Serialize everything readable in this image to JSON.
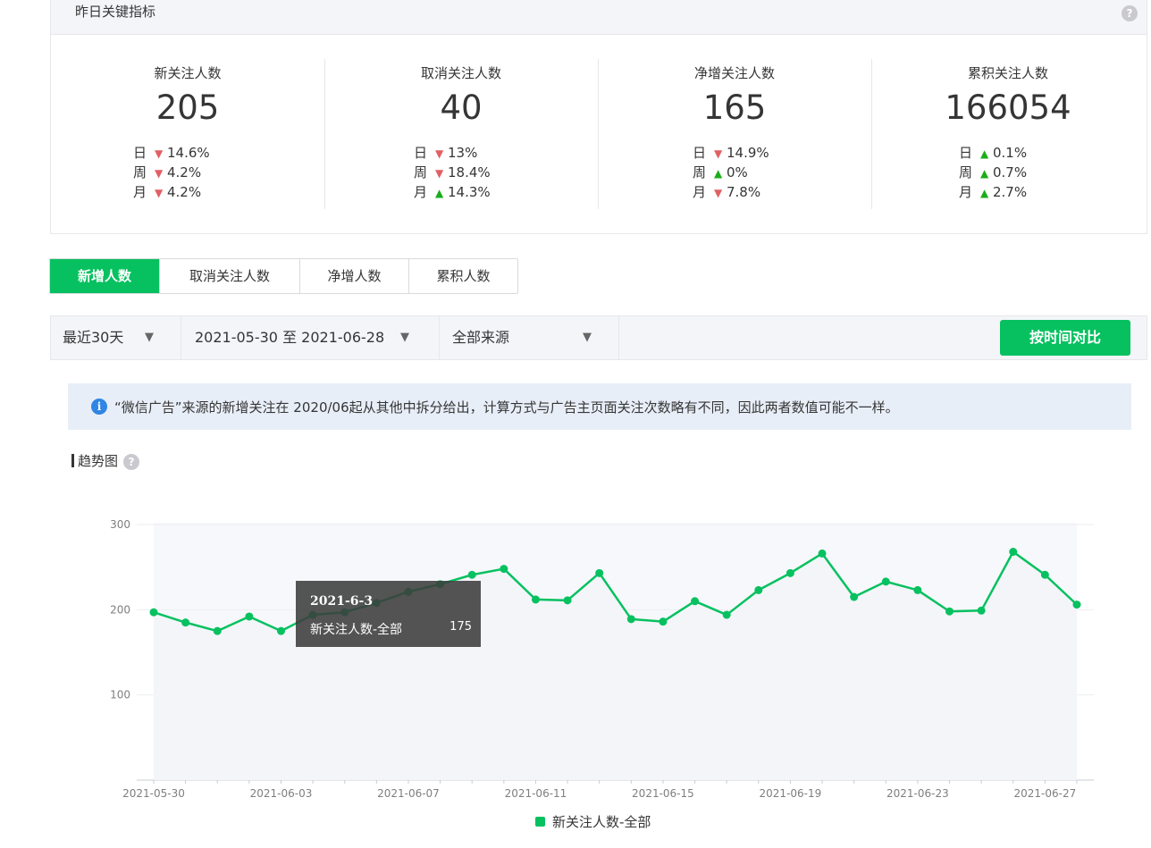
{
  "summary": {
    "title": "昨日关键指标",
    "metrics": [
      {
        "label": "新关注人数",
        "value": "205",
        "rows": [
          {
            "k": "日",
            "dir": "down",
            "v": "14.6%"
          },
          {
            "k": "周",
            "dir": "down",
            "v": "4.2%"
          },
          {
            "k": "月",
            "dir": "down",
            "v": "4.2%"
          }
        ]
      },
      {
        "label": "取消关注人数",
        "value": "40",
        "rows": [
          {
            "k": "日",
            "dir": "down",
            "v": "13%"
          },
          {
            "k": "周",
            "dir": "down",
            "v": "18.4%"
          },
          {
            "k": "月",
            "dir": "up",
            "v": "14.3%"
          }
        ]
      },
      {
        "label": "净增关注人数",
        "value": "165",
        "rows": [
          {
            "k": "日",
            "dir": "down",
            "v": "14.9%"
          },
          {
            "k": "周",
            "dir": "up",
            "v": "0%"
          },
          {
            "k": "月",
            "dir": "down",
            "v": "7.8%"
          }
        ]
      },
      {
        "label": "累积关注人数",
        "value": "166054",
        "rows": [
          {
            "k": "日",
            "dir": "up",
            "v": "0.1%"
          },
          {
            "k": "周",
            "dir": "up",
            "v": "0.7%"
          },
          {
            "k": "月",
            "dir": "up",
            "v": "2.7%"
          }
        ]
      }
    ]
  },
  "tabs": [
    "新增人数",
    "取消关注人数",
    "净增人数",
    "累积人数"
  ],
  "filters": {
    "period": "最近30天",
    "date_range": "2021-05-30 至 2021-06-28",
    "source": "全部来源",
    "compare_button": "按时间对比"
  },
  "notice": "“微信广告”来源的新增关注在 2020/06起从其他中拆分给出，计算方式与广告主页面关注次数略有不同，因此两者数值可能不一样。",
  "trend_title": "趋势图",
  "tooltip": {
    "date": "2021-6-3",
    "label": "新关注人数-全部",
    "value": "175"
  },
  "colors": {
    "accent": "#07c160",
    "down": "#e15f63",
    "up": "#1aad19",
    "info": "#2f86e4"
  },
  "chart_data": {
    "type": "line",
    "x": [
      "2021-05-30",
      "2021-05-31",
      "2021-06-01",
      "2021-06-02",
      "2021-06-03",
      "2021-06-04",
      "2021-06-05",
      "2021-06-06",
      "2021-06-07",
      "2021-06-08",
      "2021-06-09",
      "2021-06-10",
      "2021-06-11",
      "2021-06-12",
      "2021-06-13",
      "2021-06-14",
      "2021-06-15",
      "2021-06-16",
      "2021-06-17",
      "2021-06-18",
      "2021-06-19",
      "2021-06-20",
      "2021-06-21",
      "2021-06-22",
      "2021-06-23",
      "2021-06-24",
      "2021-06-25",
      "2021-06-26",
      "2021-06-27",
      "2021-06-28"
    ],
    "series": [
      {
        "name": "新关注人数-全部",
        "values": [
          197,
          185,
          175,
          192,
          175,
          194,
          197,
          208,
          221,
          230,
          241,
          248,
          212,
          211,
          243,
          189,
          186,
          210,
          194,
          223,
          243,
          266,
          215,
          233,
          223,
          198,
          199,
          268,
          241,
          206
        ]
      }
    ],
    "tick_labels": [
      "2021-05-30",
      "2021-06-03",
      "2021-06-07",
      "2021-06-11",
      "2021-06-15",
      "2021-06-19",
      "2021-06-23",
      "2021-06-27"
    ],
    "yticks": [
      100,
      200,
      300
    ],
    "ylim": [
      0,
      300
    ],
    "grid": true,
    "legend": "bottom-center"
  }
}
